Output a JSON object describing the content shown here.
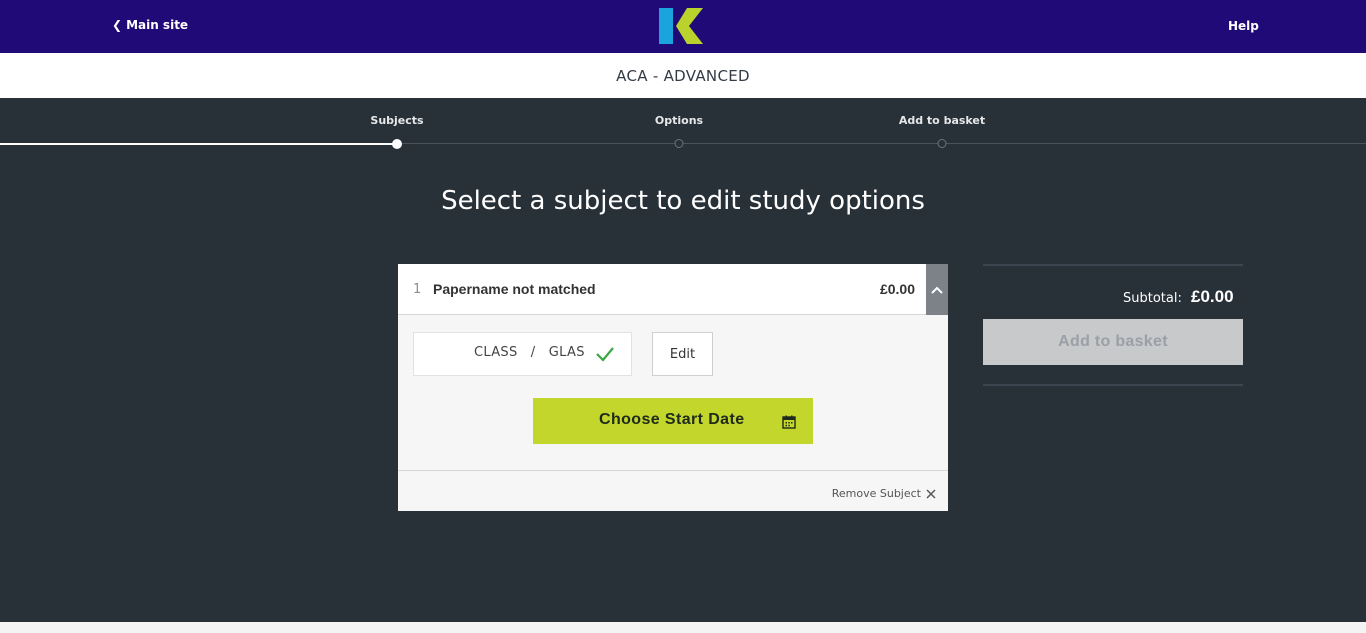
{
  "header": {
    "back_link": "Main site",
    "help_link": "Help"
  },
  "course": {
    "title": "ACA - ADVANCED"
  },
  "steps": [
    {
      "label": "Subjects",
      "state": "active"
    },
    {
      "label": "Options",
      "state": "inactive"
    },
    {
      "label": "Add to basket",
      "state": "inactive"
    }
  ],
  "heading": "Select a subject to edit study options",
  "subject": {
    "number": "1",
    "name": "Papername not matched",
    "price": "£0.00",
    "options_text": "CLASS   /   GLAS",
    "edit_label": "Edit",
    "start_date_label": "Choose Start Date",
    "remove_label": "Remove Subject"
  },
  "basket": {
    "subtotal_label": "Subtotal:",
    "subtotal_value": "£0.00",
    "add_label": "Add to basket"
  },
  "colors": {
    "brand_navy": "#1f0a78",
    "accent_lime": "#c2d62c",
    "logo_blue": "#1aa3dc",
    "dark_bg": "#283038",
    "check_green": "#3aa745"
  }
}
